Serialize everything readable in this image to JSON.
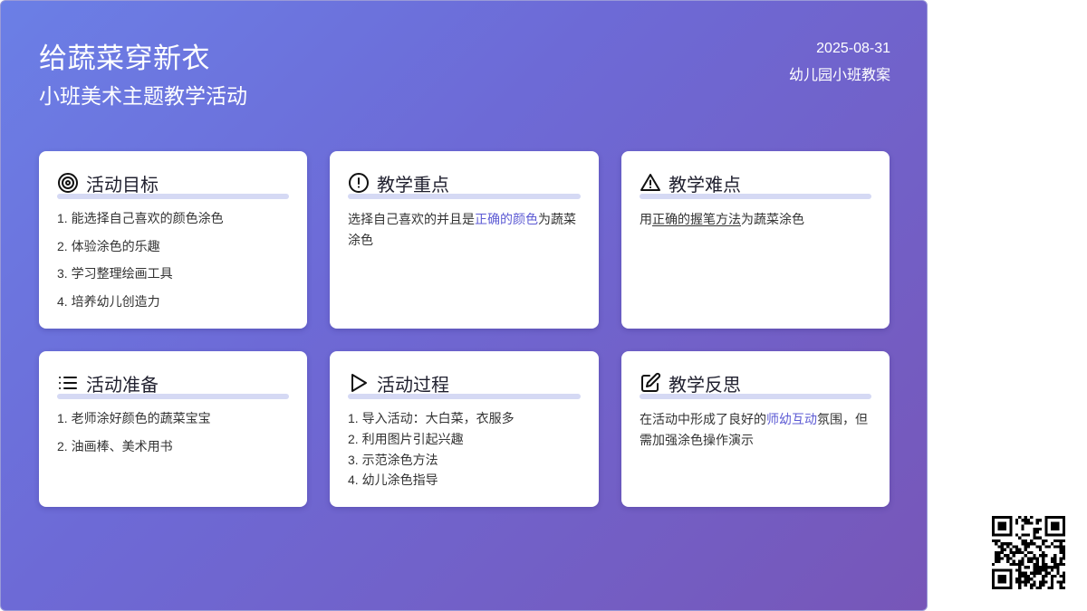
{
  "header": {
    "title": "给蔬菜穿新衣",
    "subtitle": "小班美术主题教学活动",
    "date": "2025-08-31",
    "org": "幼儿园小班教案"
  },
  "cards": {
    "goals": {
      "icon": "target-icon",
      "title": "活动目标",
      "items": [
        "1. 能选择自己喜欢的颜色涂色",
        "2. 体验涂色的乐趣",
        "3. 学习整理绘画工具",
        "4. 培养幼儿创造力"
      ]
    },
    "focus": {
      "icon": "alert-circle-icon",
      "title": "教学重点",
      "text_before": "选择自己喜欢的并且是",
      "highlight": "正确的颜色",
      "text_after": "为蔬菜涂色"
    },
    "difficulty": {
      "icon": "warning-triangle-icon",
      "title": "教学难点",
      "text_before": "用",
      "underlined": "正确的握笔方法",
      "text_after": "为蔬菜涂色"
    },
    "preparation": {
      "icon": "list-icon",
      "title": "活动准备",
      "items": [
        "1. 老师涂好颜色的蔬菜宝宝",
        "2. 油画棒、美术用书"
      ]
    },
    "process": {
      "icon": "play-icon",
      "title": "活动过程",
      "items": [
        "1. 导入活动：大白菜，衣服多",
        "2. 利用图片引起兴趣",
        "3. 示范涂色方法",
        "4. 幼儿涂色指导"
      ]
    },
    "reflection": {
      "icon": "edit-icon",
      "title": "教学反思",
      "text_before": "在活动中形成了良好的",
      "highlight": "师幼互动",
      "text_after": "氛围，但需加强涂色操作演示"
    }
  },
  "qr_code": {
    "icon": "qr-code-icon"
  },
  "colors": {
    "gradient_start": "#6b7fe6",
    "gradient_end": "#7756b8",
    "accent": "#5d5bd4",
    "title_bar": "#d5d9f4"
  }
}
